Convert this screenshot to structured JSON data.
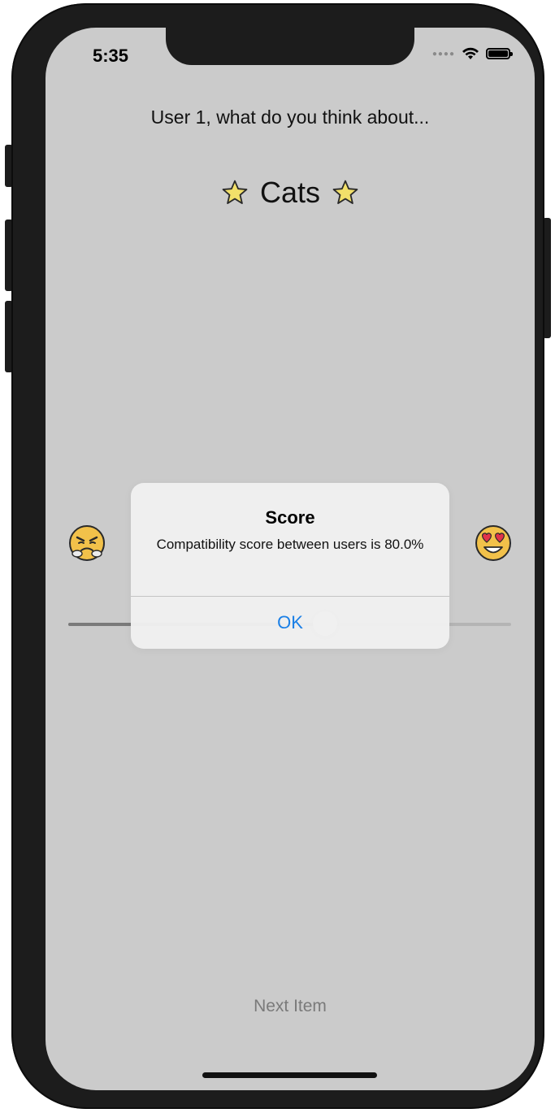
{
  "status_bar": {
    "time": "5:35",
    "signal_icon": "cellular-signal-icon",
    "wifi_icon": "wifi-icon",
    "battery_icon": "battery-icon"
  },
  "question": {
    "prompt": "User 1, what do you think about..."
  },
  "item": {
    "name": "Cats",
    "left_icon": "star-icon",
    "right_icon": "star-icon"
  },
  "rating": {
    "left_icon": "angry-face-icon",
    "right_icon": "heart-eyes-face-icon",
    "slider_value": 0.58
  },
  "footer": {
    "next_label": "Next Item"
  },
  "alert": {
    "title": "Score",
    "message": "Compatibility score between users is 80.0%",
    "button_label": "OK"
  },
  "colors": {
    "screen_bg": "#cbcbcb",
    "accent": "#1a7fe6",
    "alert_bg": "#f0f0f0"
  }
}
